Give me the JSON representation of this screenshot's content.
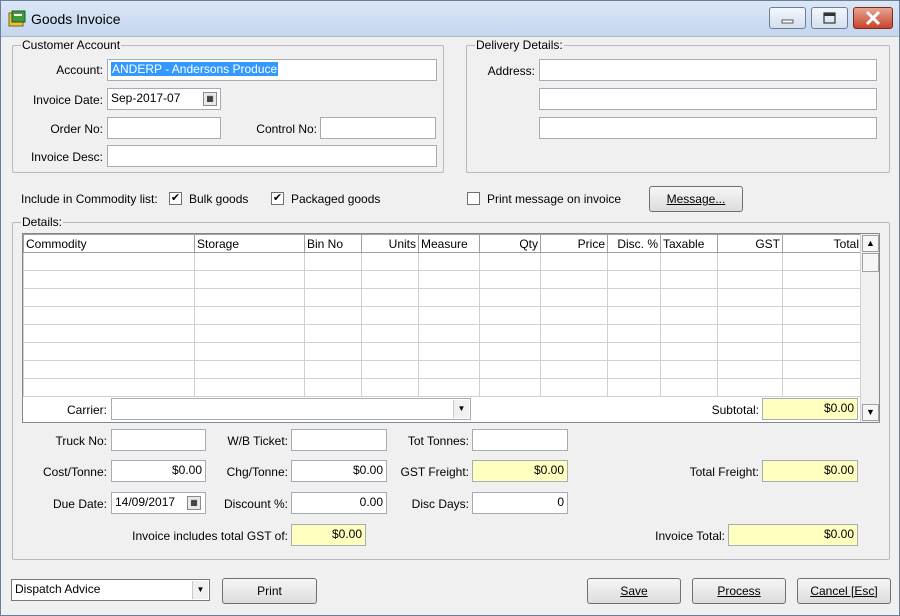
{
  "window": {
    "title": "Goods Invoice"
  },
  "customer": {
    "legend": "Customer Account",
    "account_label": "Account:",
    "account_value": "ANDERP - Andersons Produce",
    "invoice_date_label": "Invoice Date:",
    "invoice_date_value": "Sep-2017-07",
    "order_no_label": "Order No:",
    "order_no_value": "",
    "control_no_label": "Control No:",
    "control_no_value": "",
    "invoice_desc_label": "Invoice Desc:",
    "invoice_desc_value": ""
  },
  "delivery": {
    "legend": "Delivery Details:",
    "address_label": "Address:",
    "address_lines": [
      "",
      "",
      ""
    ]
  },
  "commodity": {
    "label": "Include in Commodity list:",
    "bulk_label": "Bulk goods",
    "bulk_checked": true,
    "packaged_label": "Packaged goods",
    "packaged_checked": true,
    "print_message_label": "Print message on invoice",
    "print_message_checked": false,
    "message_button": "Message..."
  },
  "details": {
    "legend": "Details:",
    "columns": [
      "Commodity",
      "Storage",
      "Bin No",
      "Units",
      "Measure",
      "Qty",
      "Price",
      "Disc. %",
      "Taxable",
      "GST",
      "Total"
    ]
  },
  "fields": {
    "carrier_label": "Carrier:",
    "carrier_value": "",
    "subtotal_label": "Subtotal:",
    "subtotal_value": "$0.00",
    "truck_no_label": "Truck No:",
    "truck_no_value": "",
    "wb_ticket_label": "W/B Ticket:",
    "wb_ticket_value": "",
    "tot_tonnes_label": "Tot Tonnes:",
    "tot_tonnes_value": "",
    "cost_tonne_label": "Cost/Tonne:",
    "cost_tonne_value": "$0.00",
    "chg_tonne_label": "Chg/Tonne:",
    "chg_tonne_value": "$0.00",
    "gst_freight_label": "GST Freight:",
    "gst_freight_value": "$0.00",
    "total_freight_label": "Total Freight:",
    "total_freight_value": "$0.00",
    "due_date_label": "Due Date:",
    "due_date_value": "14/09/2017",
    "discount_label": "Discount %:",
    "discount_value": "0.00",
    "disc_days_label": "Disc Days:",
    "disc_days_value": "0",
    "gst_total_label": "Invoice includes total GST of:",
    "gst_total_value": "$0.00",
    "invoice_total_label": "Invoice Total:",
    "invoice_total_value": "$0.00"
  },
  "footer": {
    "print_type_value": "Dispatch Advice",
    "print_button": "Print",
    "save_button": "Save",
    "process_button": "Process",
    "cancel_button": "Cancel [Esc]"
  },
  "colors": {
    "title_gradient": "#c4d6ee",
    "highlight": "#3399ff",
    "total_field": "#ffffc0",
    "close_button": "#c7432b"
  }
}
